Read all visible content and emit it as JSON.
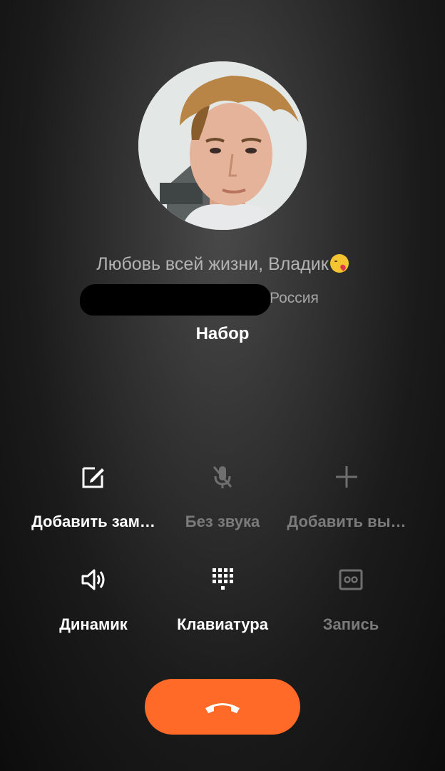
{
  "contact": {
    "name": "Любовь всей жизни, Владик",
    "emoji": "kissing-heart-emoji",
    "location": "Россия",
    "status": "Набор"
  },
  "actions": [
    {
      "id": "add-note",
      "label": "Добавить зам…",
      "icon": "edit-note-icon",
      "enabled": true
    },
    {
      "id": "mute",
      "label": "Без звука",
      "icon": "microphone-off-icon",
      "enabled": false
    },
    {
      "id": "add-call",
      "label": "Добавить вы…",
      "icon": "plus-icon",
      "enabled": false
    },
    {
      "id": "speaker",
      "label": "Динамик",
      "icon": "speaker-icon",
      "enabled": true
    },
    {
      "id": "keypad",
      "label": "Клавиатура",
      "icon": "dialpad-icon",
      "enabled": true
    },
    {
      "id": "record",
      "label": "Запись",
      "icon": "voicemail-record-icon",
      "enabled": false
    }
  ],
  "end_call": {
    "icon": "hang-up-icon",
    "color": "#ff6a28"
  }
}
